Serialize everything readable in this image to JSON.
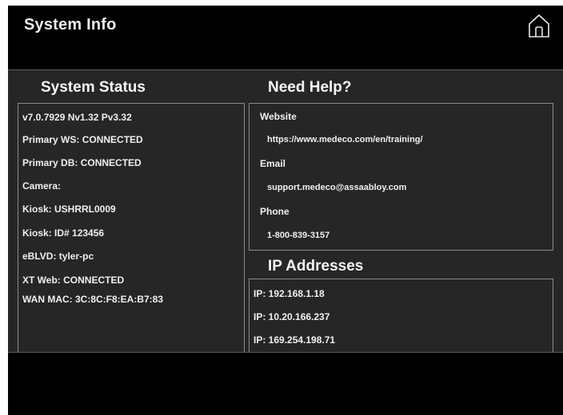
{
  "header": {
    "title": "System Info",
    "home_icon": "home-icon"
  },
  "system_status": {
    "heading": "System Status",
    "lines": [
      "v7.0.7929 Nv1.32 Pv3.32",
      "Primary WS: CONNECTED",
      "Primary DB: CONNECTED",
      "Camera:",
      "Kiosk: USHRRL0009",
      "Kiosk: ID# 123456",
      "eBLVD: tyler-pc",
      "XT Web: CONNECTED",
      "WAN MAC: 3C:8C:F8:EA:B7:83"
    ]
  },
  "help": {
    "heading": "Need Help?",
    "website_label": "Website",
    "website_value": "https://www.medeco.com/en/training/",
    "email_label": "Email",
    "email_value": "support.medeco@assaabloy.com",
    "phone_label": "Phone",
    "phone_value": "1-800-839-3157"
  },
  "ip_addresses": {
    "heading": "IP Addresses",
    "items": [
      "IP: 192.168.1.18",
      "IP: 10.20.166.237",
      "IP: 169.254.198.71"
    ]
  },
  "colors": {
    "background": "#000000",
    "content_background": "#262626",
    "border": "#8a8a8a",
    "text": "#f0f0f0"
  }
}
